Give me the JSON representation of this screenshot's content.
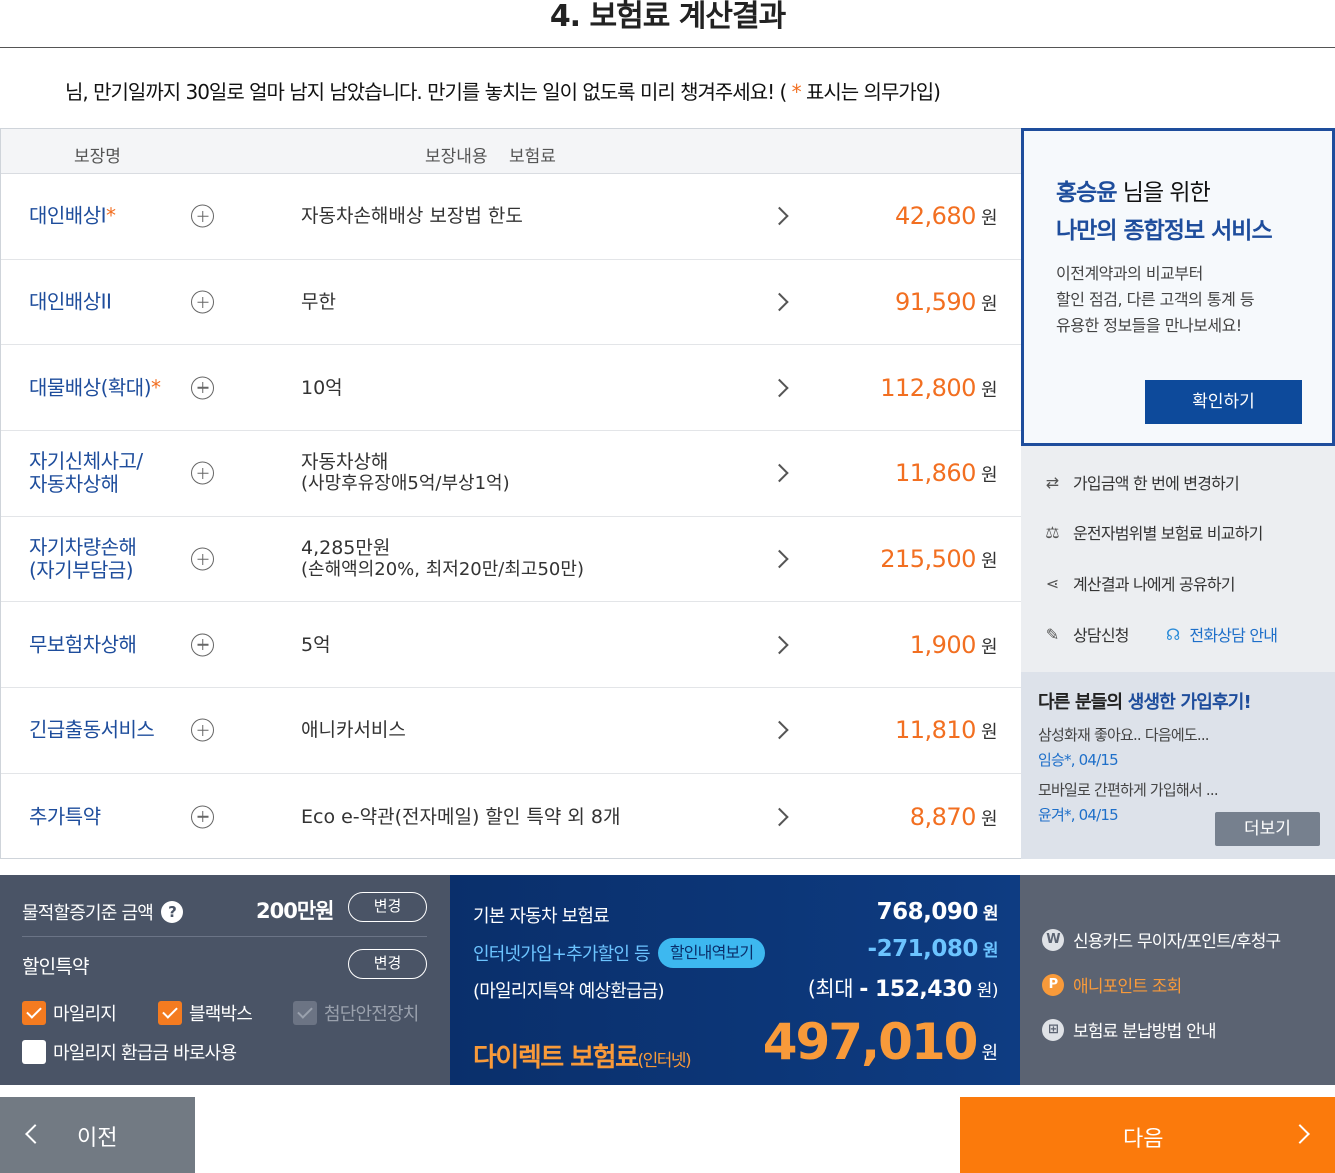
{
  "page_title": "4. 보험료 계산결과",
  "notice": {
    "text": "님, 만기일까지 30일로 얼마 남지 남았습니다. 만기를 놓치는 일이 없도록 미리 챙겨주세요! (",
    "star": " * ",
    "suffix": "표시는 의무가입)"
  },
  "table": {
    "headers": {
      "name": "보장명",
      "content": "보장내용",
      "premium": "보험료"
    },
    "currency": "원",
    "rows": [
      {
        "name": "대인배상I",
        "required": "*",
        "content": "자동차손해배상 보장법 한도",
        "content_sub": "",
        "amount": "42,680"
      },
      {
        "name": "대인배상II",
        "required": "",
        "content": "무한",
        "content_sub": "",
        "amount": "91,590"
      },
      {
        "name": "대물배상(확대)",
        "required": "*",
        "content": "10억",
        "content_sub": "",
        "amount": "112,800"
      },
      {
        "name": "자기신체사고/\n자동차상해",
        "required": "",
        "content": "자동차상해",
        "content_sub": "(사망후유장애5억/부상1억)",
        "amount": "11,860"
      },
      {
        "name": "자기차량손해\n(자기부담금)",
        "required": "",
        "content": "4,285만원",
        "content_sub": "(손해액의20%, 최저20만/최고50만)",
        "amount": "215,500"
      },
      {
        "name": "무보험차상해",
        "required": "",
        "content": "5억",
        "content_sub": "",
        "amount": "1,900"
      },
      {
        "name": "긴급출동서비스",
        "required": "",
        "content": "애니카서비스",
        "content_sub": "",
        "amount": "11,810"
      },
      {
        "name": "추가특약",
        "required": "",
        "content": "Eco e-약관(전자메일) 할인 특약 외 8개",
        "content_sub": "",
        "amount": "8,870"
      }
    ]
  },
  "side_card": {
    "user_name": "홍승윤",
    "line1_suffix": " 님을 위한",
    "line2": "나만의 종합정보 서비스",
    "desc": "이전계약과의 비교부터\n할인 점검, 다른 고객의 통계 등\n유용한 정보들을 만나보세요!",
    "confirm_button": "확인하기"
  },
  "side_links": {
    "change_amount": "가입금액 한 번에 변경하기",
    "compare_driver": "운전자범위별 보험료 비교하기",
    "share": "계산결과 나에게 공유하기",
    "consult": "상담신청",
    "phone": "전화상담 안내"
  },
  "reviews": {
    "title_prefix": "다른 분들의 ",
    "title_highlight": "생생한 가입후기!",
    "items": [
      {
        "text": "삼성화재 좋아요.. 다음에도...",
        "author": "임승*, 04/15"
      },
      {
        "text": "모바일로 간편하게 가입해서 ...",
        "author": "윤겨*, 04/15"
      }
    ],
    "more_button": "더보기"
  },
  "options": {
    "property_label": "물적할증기준 금액",
    "help_icon": "?",
    "property_value": "200만원",
    "change_button": "변경",
    "discount_label": "할인특약",
    "discount_change_button": "변경",
    "checkboxes": [
      {
        "label": "마일리지",
        "state": "checked"
      },
      {
        "label": "블랙박스",
        "state": "checked"
      },
      {
        "label": "첨단안전장치",
        "state": "disabled"
      },
      {
        "label": "마일리지 환급금 바로사용",
        "state": "unchecked"
      }
    ]
  },
  "summary": {
    "base_label": "기본 자동차 보험료",
    "base_value": "768,090",
    "discount_label": "인터넷가입+추가할인 등",
    "discount_pill": "할인내역보기",
    "discount_value": "-271,080",
    "refund_label": "(마일리지특약 예상환급금)",
    "refund_prefix": "(최대 ",
    "refund_value": "- 152,430",
    "refund_suffix": "원)",
    "direct_label": "다이렉트 보험료",
    "direct_sub": "(인터넷)",
    "direct_value": "497,010",
    "currency": "원"
  },
  "payment": {
    "card": "신용카드 무이자/포인트/후청구",
    "card_icon": "W",
    "point": "애니포인트 조회",
    "point_icon": "P",
    "installment": "보험료 분납방법 안내",
    "installment_icon": "⊞"
  },
  "nav": {
    "prev": "이전",
    "next": "다음"
  },
  "colors": {
    "accent_orange": "#f26f21",
    "brand_blue": "#1e4d9c",
    "next_button": "#fb7a0c"
  }
}
